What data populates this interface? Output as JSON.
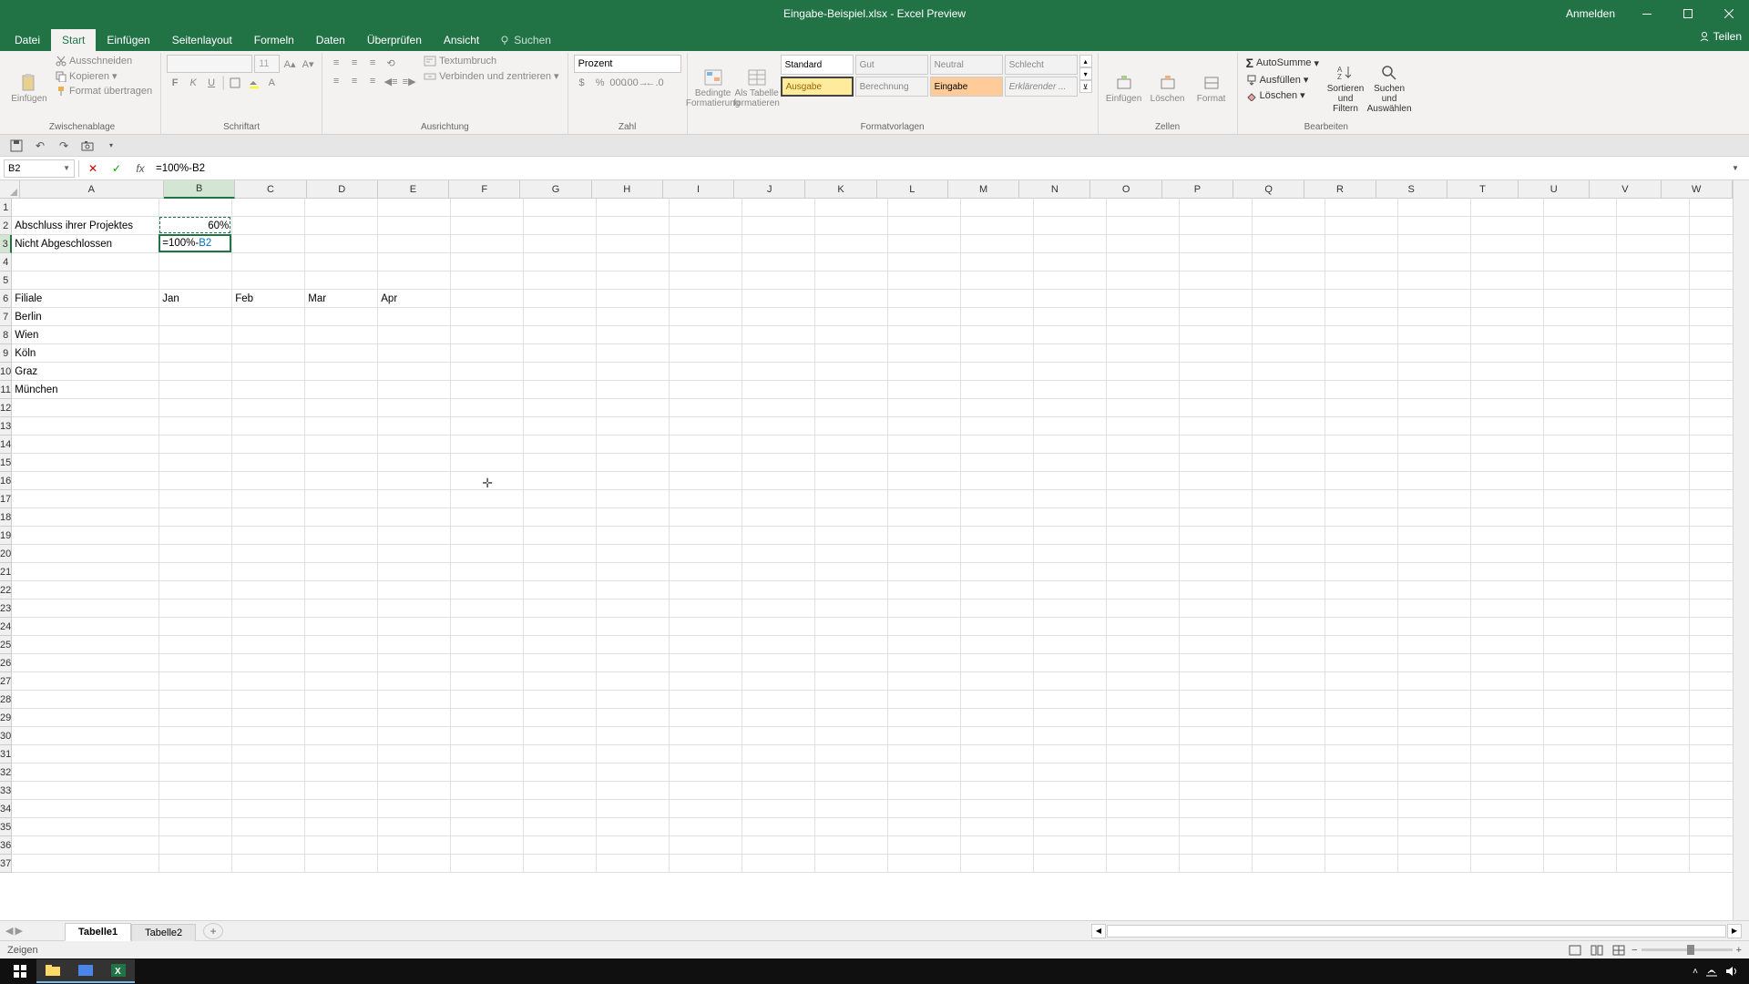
{
  "titlebar": {
    "title": "Eingabe-Beispiel.xlsx - Excel Preview",
    "signin": "Anmelden"
  },
  "tabs": {
    "file": "Datei",
    "home": "Start",
    "insert": "Einfügen",
    "pagelayout": "Seitenlayout",
    "formulas": "Formeln",
    "data": "Daten",
    "review": "Überprüfen",
    "view": "Ansicht",
    "search": "Suchen",
    "share": "Teilen"
  },
  "ribbon": {
    "clipboard": {
      "paste": "Einfügen",
      "cut": "Ausschneiden",
      "copy": "Kopieren",
      "format_painter": "Format übertragen",
      "label": "Zwischenablage"
    },
    "font": {
      "size": "11",
      "label": "Schriftart"
    },
    "alignment": {
      "wrap": "Textumbruch",
      "merge": "Verbinden und zentrieren",
      "label": "Ausrichtung"
    },
    "number": {
      "format": "Prozent",
      "label": "Zahl"
    },
    "styles": {
      "conditional": "Bedingte Formatierung",
      "table": "Als Tabelle formatieren",
      "s1": "Standard",
      "s2": "Gut",
      "s3": "Neutral",
      "s4": "Schlecht",
      "s5": "Ausgabe",
      "s6": "Berechnung",
      "s7": "Eingabe",
      "s8": "Erklärender ...",
      "label": "Formatvorlagen"
    },
    "cells": {
      "insert": "Einfügen",
      "delete": "Löschen",
      "format": "Format",
      "label": "Zellen"
    },
    "editing": {
      "autosum": "AutoSumme",
      "fill": "Ausfüllen",
      "clear": "Löschen",
      "sort": "Sortieren und Filtern",
      "find": "Suchen und Auswählen",
      "label": "Bearbeiten"
    }
  },
  "formula_bar": {
    "name_box": "B2",
    "formula": "=100%-B2"
  },
  "grid": {
    "columns": [
      "A",
      "B",
      "C",
      "D",
      "E",
      "F",
      "G",
      "H",
      "I",
      "J",
      "K",
      "L",
      "M",
      "N",
      "O",
      "P",
      "Q",
      "R",
      "S",
      "T",
      "U",
      "V",
      "W"
    ],
    "col_widths": {
      "A": 162,
      "default": 80
    },
    "row_count": 37,
    "active_col": "B",
    "active_row": 3,
    "marching_ref": "B2",
    "editing_ref": "B3",
    "editing_text_prefix": "=100%-",
    "editing_text_ref": "B2",
    "cells": {
      "A2": "Abschluss ihrer Projektes",
      "B2": "60%",
      "A3": "Nicht Abgeschlossen",
      "A6": "Filiale",
      "B6": "Jan",
      "C6": "Feb",
      "D6": "Mar",
      "E6": "Apr",
      "A7": "Berlin",
      "A8": "Wien",
      "A9": "Köln",
      "A10": "Graz",
      "A11": "München"
    },
    "cursor_pos": {
      "col": "F",
      "row": 16
    }
  },
  "sheets": {
    "tabs": [
      "Tabelle1",
      "Tabelle2"
    ],
    "active": 0
  },
  "status": {
    "mode": "Zeigen"
  },
  "taskbar": {
    "time": "",
    "date": ""
  }
}
